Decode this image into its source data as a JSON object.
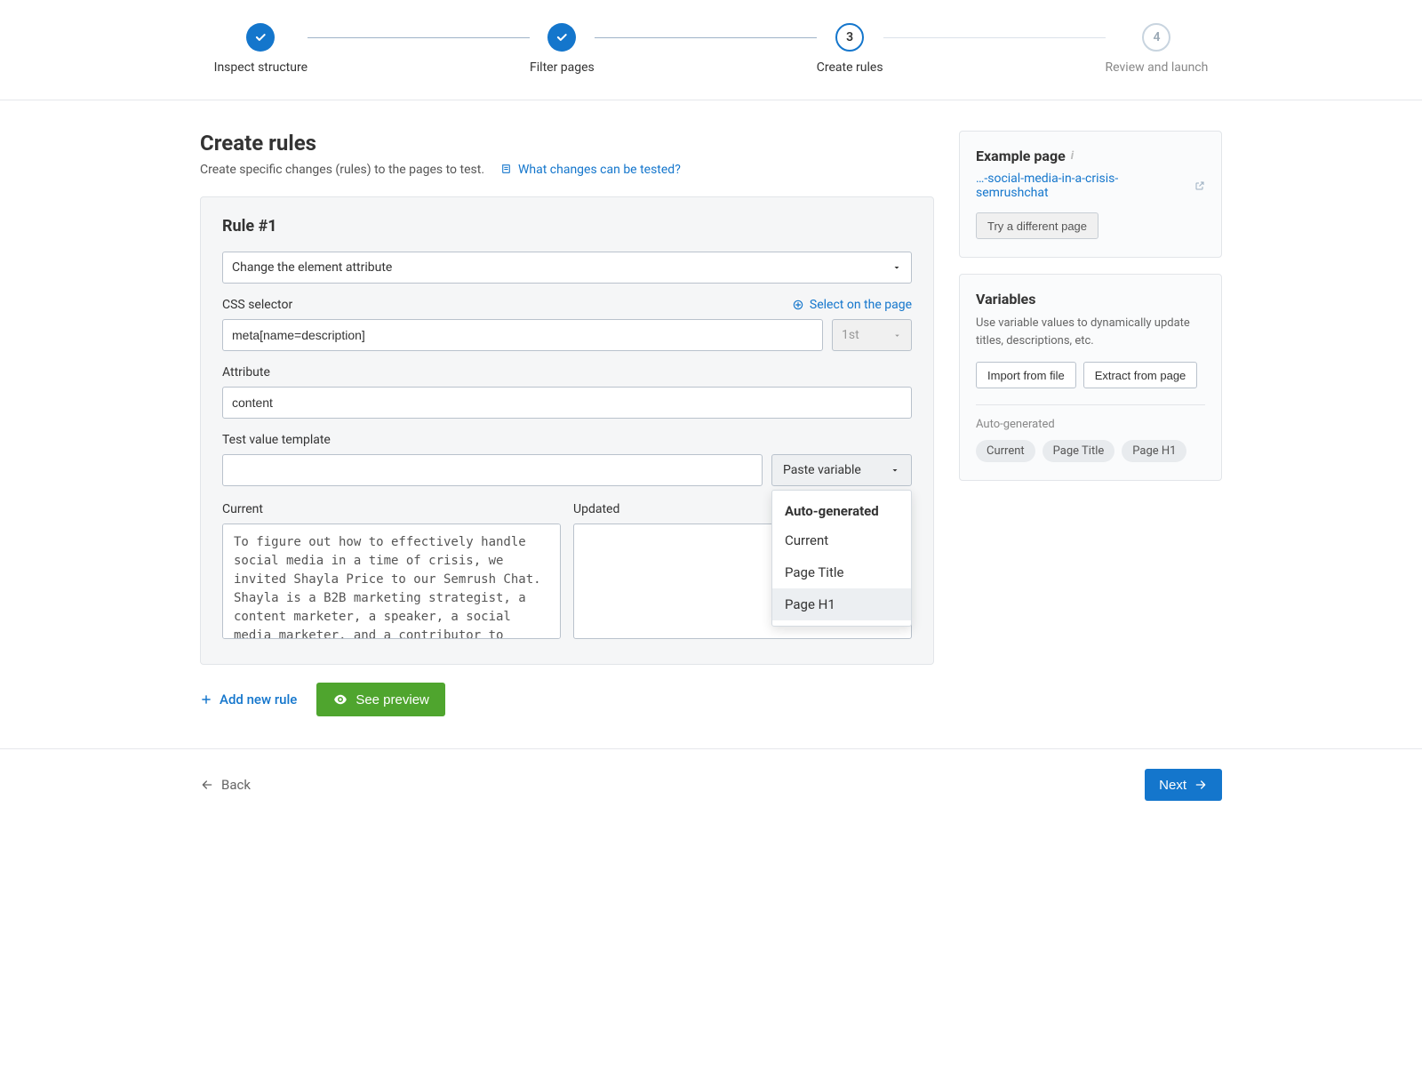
{
  "stepper": {
    "steps": [
      {
        "label": "Inspect structure",
        "state": "completed"
      },
      {
        "label": "Filter pages",
        "state": "completed"
      },
      {
        "label": "Create rules",
        "state": "current",
        "num": "3"
      },
      {
        "label": "Review and launch",
        "state": "pending",
        "num": "4"
      }
    ]
  },
  "header": {
    "title": "Create rules",
    "subtitle": "Create specific changes (rules) to the pages to test.",
    "help_link": "What changes can be tested?"
  },
  "rule": {
    "title": "Rule #1",
    "action_select": "Change the element attribute",
    "css_label": "CSS selector",
    "select_on_page": "Select on the page",
    "css_value": "meta[name=description]",
    "nth_value": "1st",
    "attr_label": "Attribute",
    "attr_value": "content",
    "tvt_label": "Test value template",
    "tvt_value": "",
    "paste_variable_label": "Paste variable",
    "dropdown": {
      "header": "Auto-generated",
      "items": [
        "Current",
        "Page Title",
        "Page H1"
      ],
      "highlighted": "Page H1"
    },
    "current_label": "Current",
    "updated_label": "Updated",
    "current_text": "To figure out how to effectively handle social media in a time of crisis, we invited Shayla Price to our Semrush Chat. Shayla is a B2B marketing strategist, a content marketer, a speaker, a social media marketer, and a contributor to",
    "updated_text": ""
  },
  "actions": {
    "add_rule": "Add new rule",
    "see_preview": "See preview"
  },
  "sidebar": {
    "example": {
      "title": "Example page",
      "link_text": "…-social-media-in-a-crisis-semrushchat",
      "try_button": "Try a different page"
    },
    "variables": {
      "title": "Variables",
      "desc": "Use variable values to dynamically update titles, descriptions, etc.",
      "import_btn": "Import from file",
      "extract_btn": "Extract from page",
      "autogen_label": "Auto-generated",
      "chips": [
        "Current",
        "Page Title",
        "Page H1"
      ]
    }
  },
  "footer": {
    "back": "Back",
    "next": "Next"
  }
}
